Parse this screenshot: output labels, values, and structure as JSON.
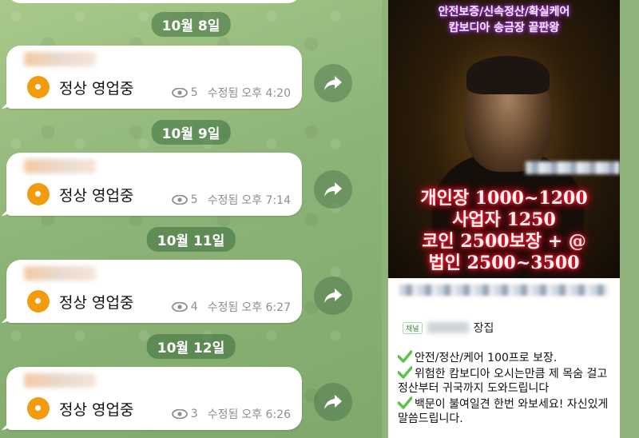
{
  "chat": {
    "messages": [
      {
        "date": "10월 8일",
        "text": "정상 영업중",
        "views": "5",
        "edited": "수정됨",
        "time": "오후 4:20"
      },
      {
        "date": "10월 9일",
        "text": "정상 영업중",
        "views": "5",
        "edited": "수정됨",
        "time": "오후 7:14"
      },
      {
        "date": "10월 11일",
        "text": "정상 영업중",
        "views": "4",
        "edited": "수정됨",
        "time": "오후 6:27"
      },
      {
        "date": "10월 12일",
        "text": "정상 영업중",
        "views": "3",
        "edited": "수정됨",
        "time": "오후 6:26"
      }
    ]
  },
  "promo": {
    "header_lines": [
      "안전보증/신속정산/확실케어",
      "캄보디아 송금장 끝판왕"
    ],
    "rates": [
      "개인장 1000~1200",
      "사업자 1250",
      "코인 2500보장 + @",
      "법인 2500~3500"
    ],
    "channel_tag": "채널",
    "channel_suffix": "장집",
    "features": [
      "안전/정산/케어 100프로 보장.",
      "위험한 캄보디아 오시는만큼 제 목숨 걸고 정산부터 귀국까지 도와드립니다",
      "백문이 불여일견 한번 와보세요! 자신있게 말씀드립니다."
    ]
  },
  "colors": {
    "accent": "#f29b0c",
    "date_pill": "#4f8a4f",
    "neon": "#ff1030",
    "check": "#5cc24a"
  }
}
